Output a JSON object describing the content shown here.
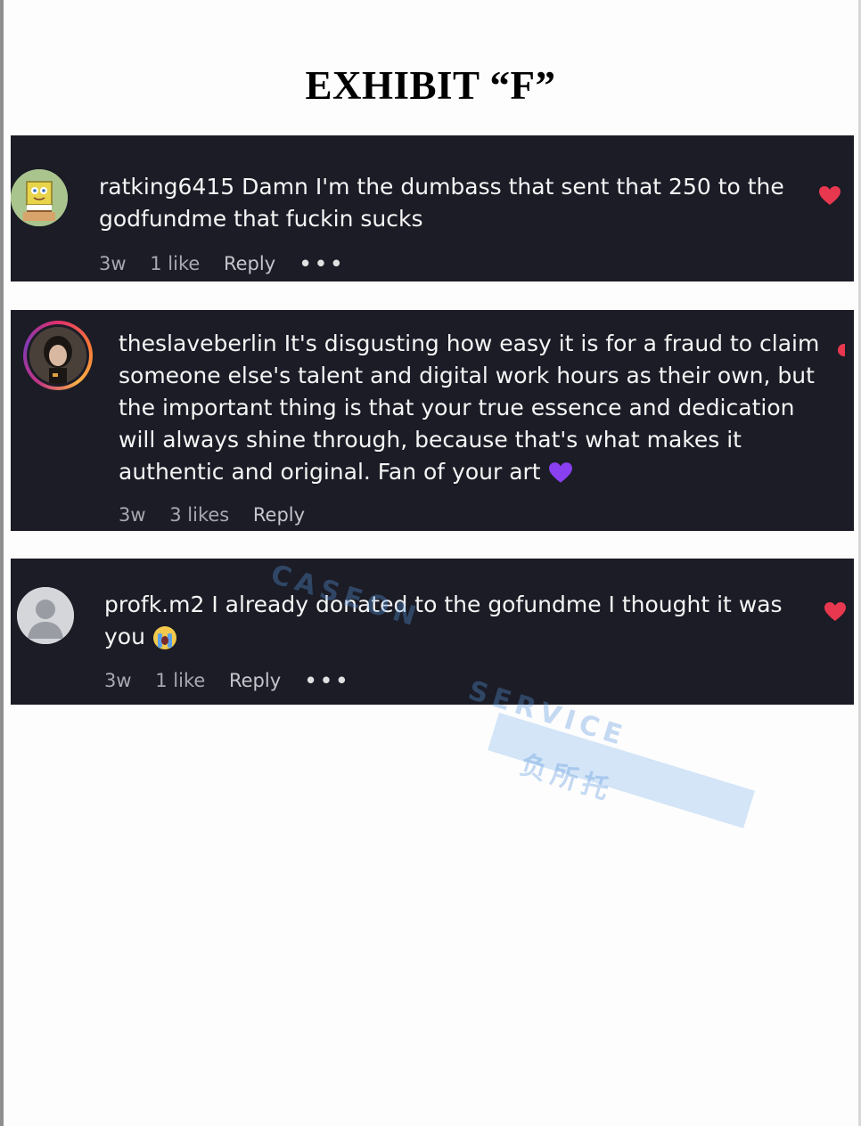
{
  "title": "EXHIBIT “F”",
  "comments": [
    {
      "username": "ratking6415",
      "text": "Damn I'm the dumbass that sent that 250 to the godfundme that fuckin sucks",
      "time": "3w",
      "likes": "1 like",
      "reply": "Reply",
      "more": "•••",
      "liked": true
    },
    {
      "username": "theslaveberlin",
      "text": "It's disgusting how easy it is for a fraud to claim someone else's talent and digital work hours as their own, but the important thing is that your true essence and dedication will always shine through, because that's what makes it authentic and original. Fan of your art",
      "emoji": "💜",
      "time": "3w",
      "likes": "3 likes",
      "reply": "Reply"
    },
    {
      "username": "profk.m2",
      "text": "I already donated to the gofundme I thought it was you",
      "emoji": "😭",
      "time": "3w",
      "likes": "1 like",
      "reply": "Reply",
      "more": "•••",
      "liked": true
    }
  ],
  "watermark": {
    "line1": "CASEON",
    "line2": "SERVICE",
    "line3": "负所托"
  },
  "colors": {
    "panel_bg": "#1b1c26",
    "heart": "#e8384f",
    "watermark": "#5a96dc"
  }
}
